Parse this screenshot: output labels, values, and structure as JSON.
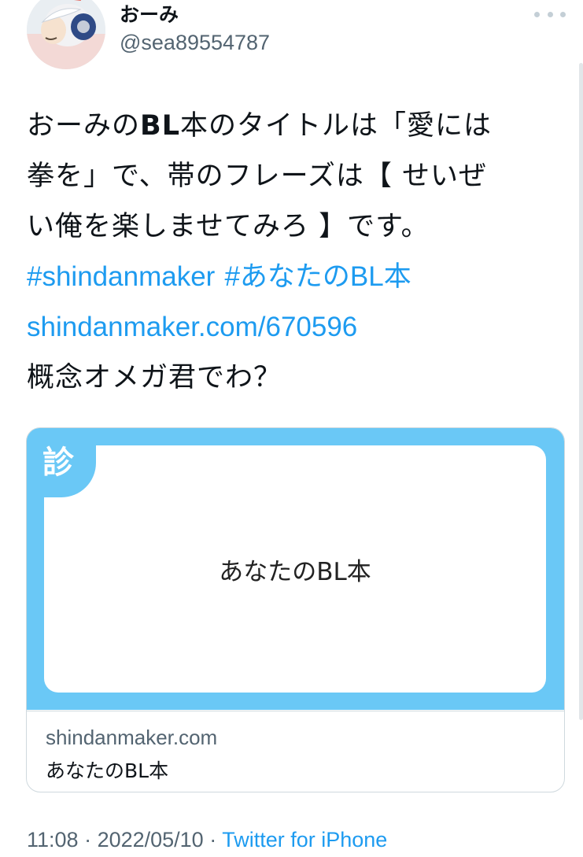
{
  "author": {
    "display_name": "おーみ",
    "handle": "@sea89554787"
  },
  "tweet": {
    "line1_a": "おーみの",
    "line1_bold": "BL",
    "line1_b": "本のタイトルは「愛には",
    "line2": "拳を」で、帯のフレーズは【 せいぜ",
    "line3": "い俺を楽しませてみろ 】です。",
    "hashtag1": "#shindanmaker",
    "hashtag2": "#あなたのBL本",
    "url": "shindanmaker.com/670596",
    "line6": "概念オメガ君でわ？"
  },
  "card": {
    "badge": "診",
    "image_title": "あなたのBL本",
    "domain": "shindanmaker.com",
    "title": "あなたのBL本",
    "colors": {
      "accent": "#6ac8f6"
    }
  },
  "meta": {
    "time": "11:08",
    "separator1": " · ",
    "date": "2022/05/10",
    "separator2": " · ",
    "source": "Twitter for iPhone"
  }
}
